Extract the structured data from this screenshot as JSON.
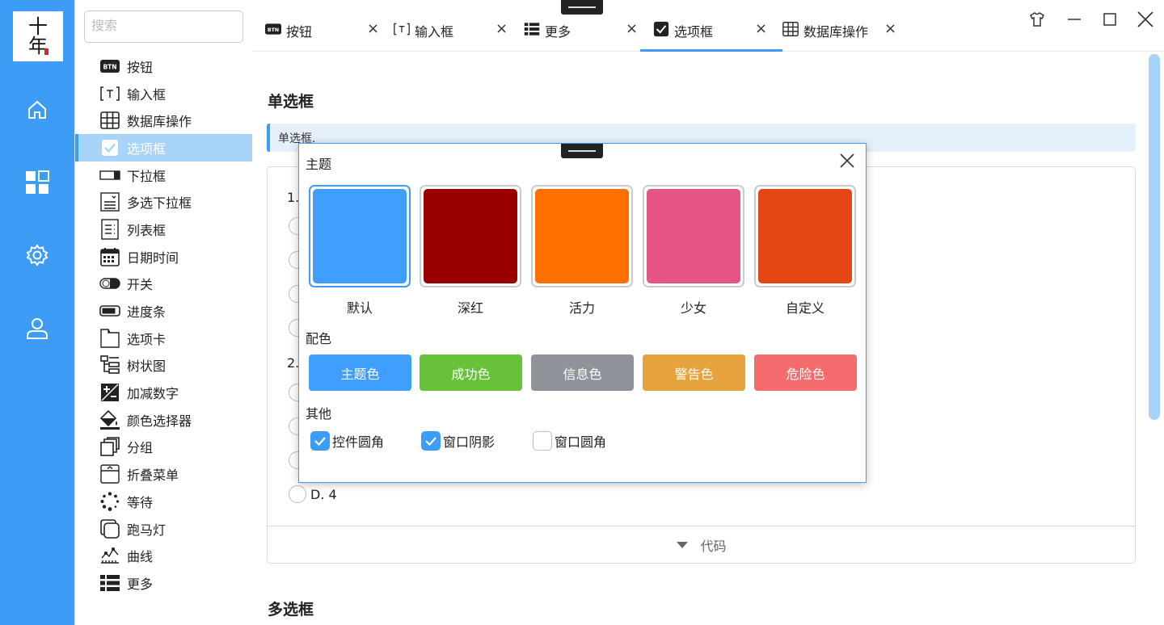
{
  "logo": {
    "line1": "十",
    "line2": "年"
  },
  "search": {
    "placeholder": "搜索"
  },
  "nav": [
    {
      "label": "按钮",
      "icon": "btn-icon"
    },
    {
      "label": "输入框",
      "icon": "textbox-icon"
    },
    {
      "label": "数据库操作",
      "icon": "table-icon"
    },
    {
      "label": "选项框",
      "icon": "checkbox-icon"
    },
    {
      "label": "下拉框",
      "icon": "dropdown-icon"
    },
    {
      "label": "多选下拉框",
      "icon": "multi-dropdown-icon"
    },
    {
      "label": "列表框",
      "icon": "listbox-icon"
    },
    {
      "label": "日期时间",
      "icon": "calendar-icon"
    },
    {
      "label": "开关",
      "icon": "toggle-icon"
    },
    {
      "label": "进度条",
      "icon": "progress-icon"
    },
    {
      "label": "选项卡",
      "icon": "tabs-icon"
    },
    {
      "label": "树状图",
      "icon": "tree-icon"
    },
    {
      "label": "加减数字",
      "icon": "plus-minus-icon"
    },
    {
      "label": "颜色选择器",
      "icon": "paint-bucket-icon"
    },
    {
      "label": "分组",
      "icon": "group-icon"
    },
    {
      "label": "折叠菜单",
      "icon": "collapse-menu-icon"
    },
    {
      "label": "等待",
      "icon": "spinner-icon"
    },
    {
      "label": "跑马灯",
      "icon": "marquee-icon"
    },
    {
      "label": "曲线",
      "icon": "curve-icon"
    },
    {
      "label": "更多",
      "icon": "more-icon"
    }
  ],
  "nav_active_index": 3,
  "tabs": [
    {
      "label": "按钮",
      "icon": "btn-icon"
    },
    {
      "label": "输入框",
      "icon": "textbox-icon"
    },
    {
      "label": "更多",
      "icon": "more-icon"
    },
    {
      "label": "选项框",
      "icon": "checkbox-icon"
    },
    {
      "label": "数据库操作",
      "icon": "table-icon"
    }
  ],
  "tab_close": "×",
  "content": {
    "section1_title": "单选框",
    "section1_note": "单选框.",
    "q1_prefix": "1.",
    "q2_prefix": "2.",
    "last_option": "D. 4",
    "code_label": "代码",
    "section2_title": "多选框"
  },
  "dialog": {
    "title": "主题",
    "themes": [
      {
        "label": "默认",
        "color": "#409eff"
      },
      {
        "label": "深红",
        "color": "#990000"
      },
      {
        "label": "活力",
        "color": "#ff7000"
      },
      {
        "label": "少女",
        "color": "#e55486"
      },
      {
        "label": "自定义",
        "color": "#e64614"
      }
    ],
    "colors_title": "配色",
    "color_buttons": [
      {
        "label": "主题色",
        "color": "#409eff"
      },
      {
        "label": "成功色",
        "color": "#67c23a"
      },
      {
        "label": "信息色",
        "color": "#909399"
      },
      {
        "label": "警告色",
        "color": "#e6a23c"
      },
      {
        "label": "危险色",
        "color": "#f56c6c"
      }
    ],
    "other_title": "其他",
    "options": [
      {
        "label": "控件圆角",
        "checked": true
      },
      {
        "label": "窗口阴影",
        "checked": true
      },
      {
        "label": "窗口圆角",
        "checked": false
      }
    ]
  },
  "accent": "#3d9cf5"
}
